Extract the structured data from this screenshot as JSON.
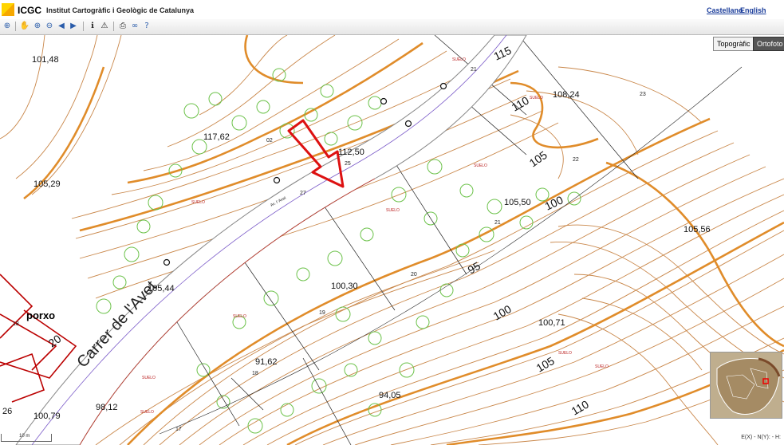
{
  "header": {
    "brand": "ICGC",
    "institute": "Institut Cartogràfic i Geològic de Catalunya",
    "lang_es": "Castellano",
    "lang_en": "English"
  },
  "toolbar": {
    "icons": [
      "zoom-extent-icon",
      "pan-hand-icon",
      "zoom-in-icon",
      "zoom-out-icon",
      "previous-view-icon",
      "next-view-icon",
      "info-icon",
      "warning-icon",
      "print-icon",
      "link-icon",
      "help-icon"
    ]
  },
  "layers": {
    "topo": "Topogràfic",
    "ortho": "Ortofoto"
  },
  "street": "Carrer de l'Avet",
  "street_small": "Av. l' Avet",
  "building_label": "porxo",
  "elevations": [
    "101,48",
    "105,29",
    "117,62",
    "112,50",
    "108,24",
    "105,50",
    "105,56",
    "105,44",
    "100,30",
    "100,71",
    "91,62",
    "94,05",
    "98,12",
    "100,79",
    "26"
  ],
  "contour_labels": [
    "115",
    "110",
    "105",
    "100",
    "95",
    "100",
    "105",
    "110",
    "20"
  ],
  "parcel_numbers": [
    "21",
    "23",
    "22",
    "21",
    "20",
    "19",
    "18",
    "17",
    "02",
    "25",
    "27",
    "18"
  ],
  "land_label": "SUELO",
  "colors": {
    "contour_index": "#e08c2a",
    "contour": "#c9874a",
    "vegetation": "#6cc24a",
    "arrow": "#d11",
    "property": "#b00"
  },
  "scale": "10 m",
  "coords": "E(X) - N(Y): - H:"
}
